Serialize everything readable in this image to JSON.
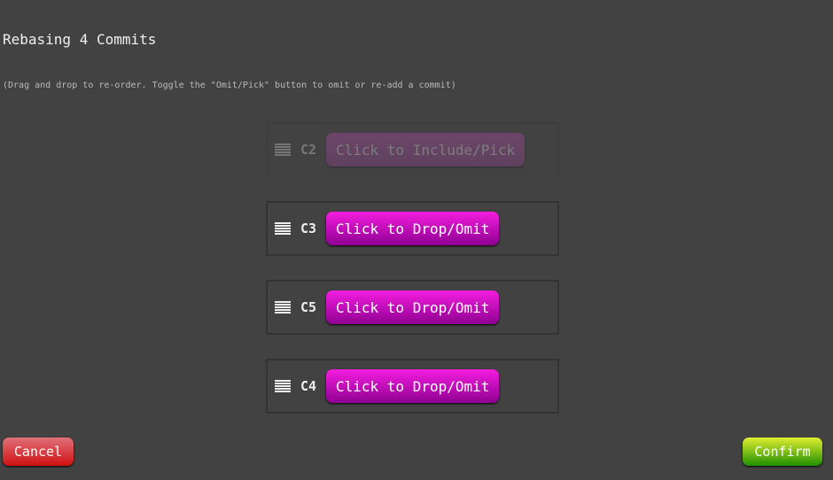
{
  "title": "Rebasing 4 Commits",
  "hint": "(Drag and drop to re-order. Toggle the \"Omit/Pick\" button to omit or re-add a commit)",
  "commits": [
    {
      "id": "C2",
      "button": "Click to Include/Pick",
      "omitted": true
    },
    {
      "id": "C3",
      "button": "Click to Drop/Omit",
      "omitted": false
    },
    {
      "id": "C5",
      "button": "Click to Drop/Omit",
      "omitted": false
    },
    {
      "id": "C4",
      "button": "Click to Drop/Omit",
      "omitted": false
    }
  ],
  "cancel": "Cancel",
  "confirm": "Confirm"
}
